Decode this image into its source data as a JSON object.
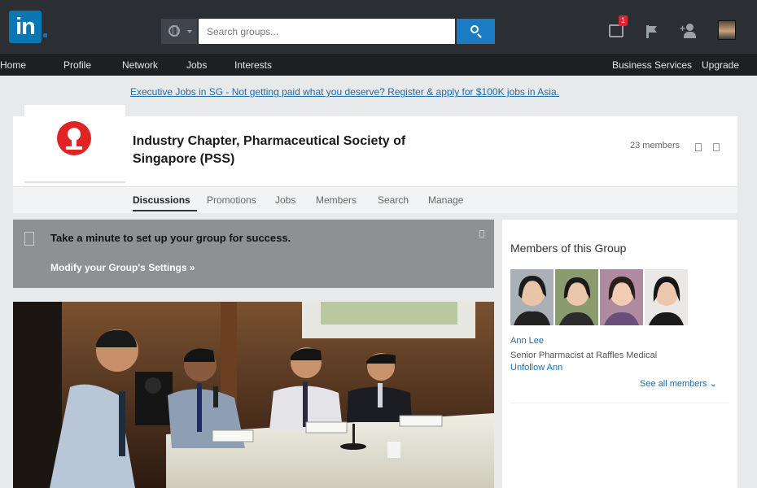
{
  "header": {
    "logo_text": "in",
    "search_placeholder": "Search groups...",
    "message_badge": "1",
    "icons": [
      "search-icon",
      "globe-icon",
      "messages-icon",
      "flag-icon",
      "add-connection-icon",
      "profile-avatar"
    ]
  },
  "nav": {
    "items": [
      "Home",
      "Profile",
      "Network",
      "Jobs",
      "Interests"
    ],
    "right_items": [
      "Business Services",
      "Upgrade"
    ]
  },
  "ad": {
    "text": "Executive Jobs in SG - Not getting paid what you deserve? Register & apply for $100K jobs in Asia."
  },
  "group": {
    "title": "Industry Chapter, Pharmaceutical Society of Singapore (PSS)",
    "members_count": "23 members",
    "tabs": [
      "Discussions",
      "Promotions",
      "Jobs",
      "Members",
      "Search",
      "Manage"
    ],
    "active_tab": "Discussions"
  },
  "setup_banner": {
    "title": "Take a minute to set up your group for success.",
    "link": "Modify your Group's Settings »"
  },
  "sidebar": {
    "title": "Members of this Group",
    "member_name": "Ann Lee",
    "member_role": "Senior Pharmacist at Raffles Medical",
    "unfollow": "Unfollow Ann",
    "see_all": "See all members ⌄"
  },
  "colors": {
    "topbar": "#2b2f33",
    "navbar": "#1d1f22",
    "linkedin_blue": "#0a77b5",
    "search_button": "#1b7cc3",
    "link": "#1f6baa",
    "setup_banner": "#8e9193",
    "group_logo_red": "#e02424"
  }
}
